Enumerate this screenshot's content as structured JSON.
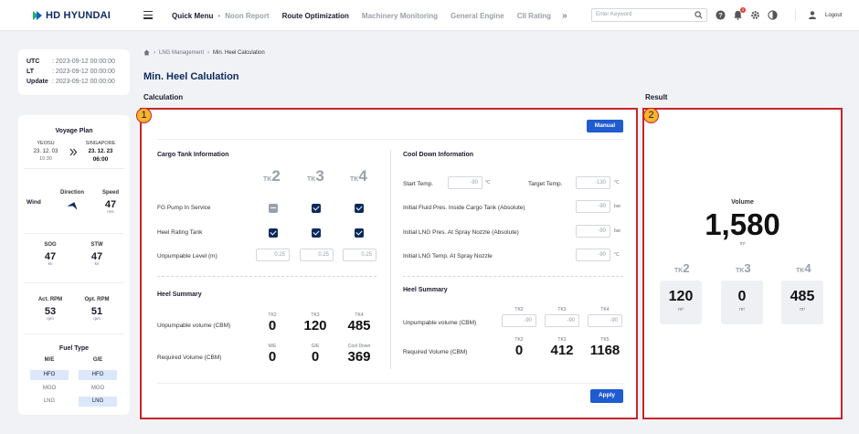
{
  "brand": {
    "name": "HD HYUNDAI",
    "mark_colors": [
      "#1db36b",
      "#0b5fd1"
    ]
  },
  "nav": {
    "items": [
      {
        "label": "Quick Menu",
        "active": true
      },
      {
        "label": "Noon Report",
        "active": false
      },
      {
        "label": "Route Optimization",
        "active": true
      },
      {
        "label": "Machinery Monitoring",
        "active": false
      },
      {
        "label": "General Engine",
        "active": false
      },
      {
        "label": "CII Rating",
        "active": false
      }
    ],
    "more": "»"
  },
  "search": {
    "placeholder": "Enter Keyword"
  },
  "notifications": {
    "count": "3"
  },
  "user": {
    "logout": "Logout"
  },
  "times": [
    {
      "label": "UTC",
      "value": ": 2023-09-12 00:00:00"
    },
    {
      "label": "LT",
      "value": ": 2023-09-12 00:00:00"
    },
    {
      "label": "Update",
      "value": ": 2023-09-12 00:00:00"
    }
  ],
  "voyage": {
    "title": "Voyage Plan",
    "from": {
      "port": "YEOSU",
      "date": "23. 12. 03",
      "time": "10:30"
    },
    "to": {
      "port": "SINGAPORE",
      "date": "23. 12. 23",
      "time": "06:00"
    },
    "wind_label": "Wind",
    "direction_label": "Direction",
    "speed_label": "Speed",
    "speed_value": "47",
    "speed_unit": "m/s",
    "sog_label": "SOG",
    "sog_value": "47",
    "sog_unit": "kn",
    "stw_label": "STW",
    "stw_value": "47",
    "stw_unit": "kn",
    "act_rpm_label": "Act. RPM",
    "act_rpm_value": "53",
    "act_rpm_unit": "rpm",
    "opt_rpm_label": "Opt. RPM",
    "opt_rpm_value": "51",
    "opt_rpm_unit": "rpm",
    "fuel_title": "Fuel Type",
    "me_label": "M/E",
    "ge_label": "G/E",
    "fuels": [
      "HFO",
      "MGO",
      "LNG"
    ]
  },
  "breadcrumb": {
    "parent": "LNG Management",
    "current": "Min. Heel Calculation"
  },
  "page_title": "Min. Heel Calulation",
  "calc_heading": "Calculation",
  "result_heading": "Result",
  "markers": {
    "one": "1",
    "two": "2"
  },
  "buttons": {
    "manual": "Manual",
    "apply": "Apply"
  },
  "cargo": {
    "title": "Cargo Tank Information",
    "tk_prefix": "TK",
    "tanks": [
      "2",
      "3",
      "4"
    ],
    "fg_pump": "FG Pump In Service",
    "heel_tank": "Heel Rating Tank",
    "unpumpable": "Unpumpable Level (m)",
    "unpumpable_values": [
      "0.25",
      "0.25",
      "0.25"
    ]
  },
  "cool": {
    "title": "Cool Down Information",
    "start_temp": "Start Temp.",
    "start_value": "-90",
    "start_unit": "°C",
    "target_temp": "Target Temp.",
    "target_value": "-130",
    "target_unit": "°C",
    "fluid_pres": "Initial Fluid Pres. Inside Cargo Tank (Absolute)",
    "fluid_value": "-90",
    "fluid_unit": "bar",
    "lng_pres": "Initial LNG Pres. At Spray Nozzle (Absolute)",
    "lng_pres_value": "-90",
    "lng_pres_unit": "bar",
    "lng_temp": "Initial LNG Temp. At Spray Nozzle",
    "lng_temp_value": "-90",
    "lng_temp_unit": "°C"
  },
  "heel_left": {
    "title": "Heel Summary",
    "unpumpable": "Unpumpable volume (CBM)",
    "required": "Required Volume (CBM)",
    "heads_top": [
      "TK2",
      "TK3",
      "TK4"
    ],
    "vals_top": [
      "0",
      "120",
      "485"
    ],
    "heads_bottom": [
      "M/E",
      "G/E",
      "Cool Down"
    ],
    "vals_bottom": [
      "0",
      "0",
      "369"
    ]
  },
  "heel_right": {
    "title": "Heel Summary",
    "unpumpable": "Unpumpable volume (CBM)",
    "required": "Required Volume (CBM)",
    "heads_top": [
      "TK2",
      "TK3",
      "TK4"
    ],
    "inputs": [
      "-90",
      "-90",
      "-90"
    ],
    "heads_bottom": [
      "TK2",
      "TK3",
      "TK5"
    ],
    "vals_bottom": [
      "0",
      "412",
      "1168"
    ]
  },
  "result": {
    "volume_label": "Volume",
    "volume_value": "1,580",
    "volume_unit": "m³",
    "tanks": [
      {
        "prefix": "TK",
        "num": "2",
        "value": "120",
        "unit": "m³"
      },
      {
        "prefix": "TK",
        "num": "3",
        "value": "0",
        "unit": "m³"
      },
      {
        "prefix": "TK",
        "num": "4",
        "value": "485",
        "unit": "m³"
      }
    ]
  }
}
